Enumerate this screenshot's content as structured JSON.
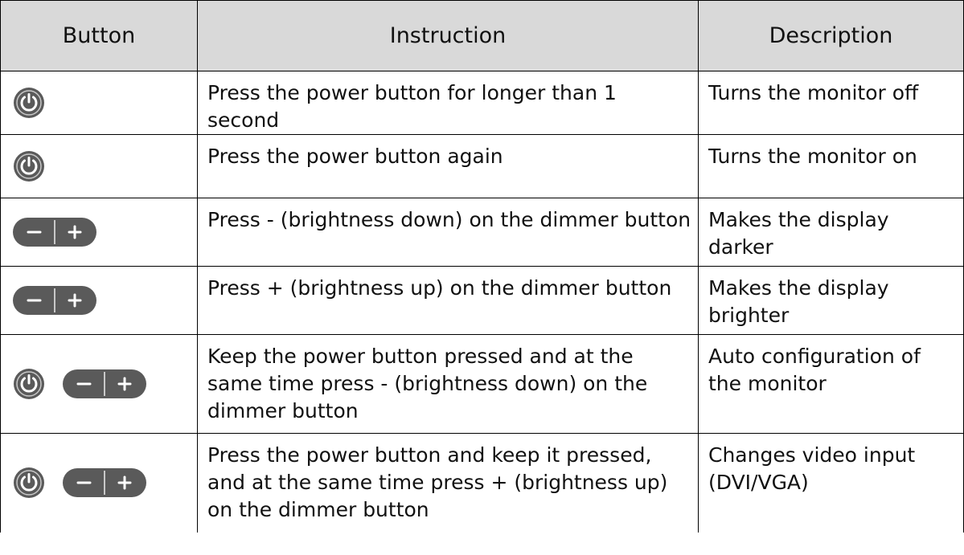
{
  "headers": {
    "button": "Button",
    "instruction": "Instruction",
    "description": "Description"
  },
  "rows": [
    {
      "icons": [
        "power-button-icon"
      ],
      "instruction": "Press the power button for longer than 1 second",
      "description": "Turns the monitor off"
    },
    {
      "icons": [
        "power-button-icon"
      ],
      "instruction": "Press the power button again",
      "description": "Turns the monitor on"
    },
    {
      "icons": [
        "dimmer-button-icon"
      ],
      "instruction": "Press - (brightness down) on the dimmer button",
      "description": "Makes the display darker"
    },
    {
      "icons": [
        "dimmer-button-icon"
      ],
      "instruction": "Press + (brightness up) on the dimmer button",
      "description": "Makes the display brighter"
    },
    {
      "icons": [
        "power-button-icon",
        "dimmer-button-icon"
      ],
      "instruction": "Keep the power button pressed and at the same time press - (brightness down) on the dimmer button",
      "description": "Auto configuration of the monitor"
    },
    {
      "icons": [
        "power-button-icon",
        "dimmer-button-icon"
      ],
      "instruction": "Press the power button and keep it pressed, and at the same time press + (brightness up) on the dimmer button",
      "description": "Changes video input (DVI/VGA)"
    }
  ],
  "colors": {
    "header_bg": "#d9d9d9",
    "button_body": "#5a5a5a",
    "button_ring": "#c8c8c8",
    "border": "#000000"
  }
}
